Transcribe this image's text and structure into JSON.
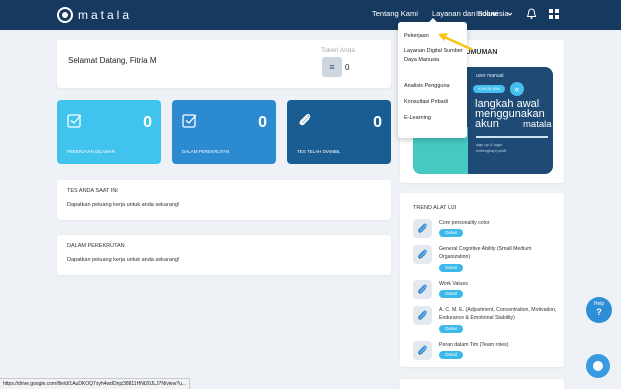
{
  "header": {
    "brand": "matala",
    "nav": [
      "Tentang Kami",
      "Layanan dan Solusi",
      "Indonesia"
    ],
    "icons": [
      "chevron-down-icon",
      "bell-icon",
      "grid-icon"
    ]
  },
  "welcome": {
    "greeting": "Selamat Datang, Fitria M",
    "token_label": "Token Anda",
    "token_value": "0"
  },
  "stats": [
    {
      "label": "PEKERJAAN DILAMAR",
      "value": "0",
      "color": "#40c4ee"
    },
    {
      "label": "DALAM PEREKRUTAN",
      "value": "0",
      "color": "#2b8ad0"
    },
    {
      "label": "TES TELAH DIAMBIL",
      "value": "0",
      "color": "#1a5d92"
    }
  ],
  "sections": [
    {
      "heading": "TES ANDA SAAT INI",
      "text": "Dapatkan peluang kerja untuk anda sekarang!"
    },
    {
      "heading": "DALAM PEREKRUTAN",
      "text": "Dapatkan peluang kerja untuk anda sekarang!"
    }
  ],
  "announcement": {
    "title": "NGUMUMAN",
    "small": "user manual",
    "button": "KLIK DI SINI",
    "big": "langkah awal menggunakan akun",
    "brand": "matala",
    "signup": "sign up & login\nmelengkapi profil"
  },
  "trend": {
    "title": "TREND ALAT UJI",
    "detail_label": "Detail",
    "items": [
      {
        "name": "Core personality color"
      },
      {
        "name": "General Cognitive Ability (Small Medium Organization)"
      },
      {
        "name": "Work Values"
      },
      {
        "name": "A. C. M. E. (Adjustment, Concentration, Motivation, Endurance & Emotional Stability)"
      },
      {
        "name": "Peran dalam Tim (Team roles)"
      }
    ]
  },
  "dropdown": {
    "items": [
      "Pekerjaan",
      "Layanan Digital Sumber Daya Manusia",
      "Analisis Pengguna",
      "Konsultasi Pribadi",
      "E-Learning"
    ]
  },
  "help": {
    "line1": "Help",
    "line2": "?"
  },
  "statusbar": {
    "url": "https://drive.google.com/file/d/1AuDKOQ7xyh4wdOnjz38811HNt20JLJ7N/view?u..."
  }
}
